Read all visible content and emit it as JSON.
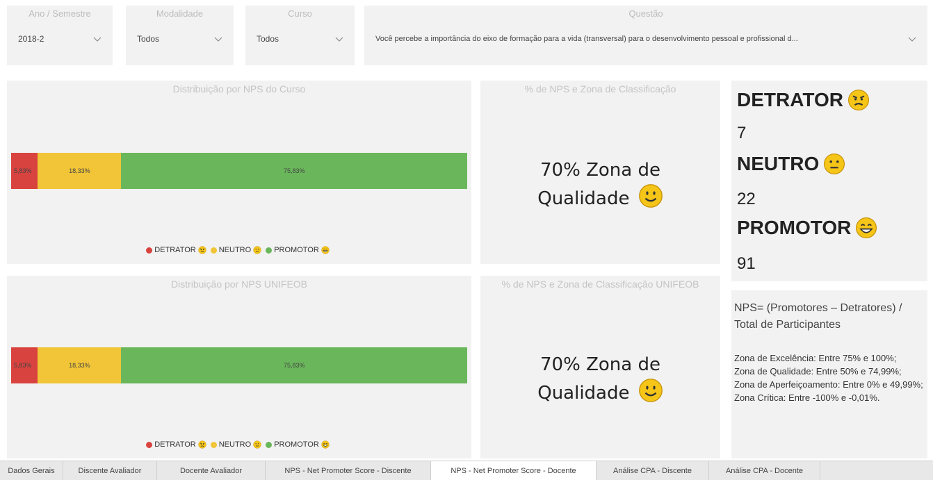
{
  "filters": {
    "ano": {
      "title": "Ano / Semestre",
      "value": "2018-2"
    },
    "modalidade": {
      "title": "Modalidade",
      "value": "Todos"
    },
    "curso": {
      "title": "Curso",
      "value": "Todos"
    },
    "questao": {
      "title": "Questão",
      "value": "Você percebe a importância do eixo de formação para a vida (transversal) para o desenvolvimento pessoal e profissional d..."
    }
  },
  "colors": {
    "detrator": "#d9433f",
    "neutro": "#f1c537",
    "promotor": "#6ab75b",
    "emoji": "#f5c518"
  },
  "chart_data": [
    {
      "type": "bar",
      "title": "Distribuição por NPS do Curso",
      "orientation": "horizontal-stacked-100",
      "series": [
        {
          "name": "DETRATOR",
          "value": 5.83,
          "label": "5,83%"
        },
        {
          "name": "NEUTRO",
          "value": 18.33,
          "label": "18,33%"
        },
        {
          "name": "PROMOTOR",
          "value": 75.83,
          "label": "75,83%"
        }
      ],
      "legend": [
        "DETRATOR",
        "NEUTRO",
        "PROMOTOR"
      ],
      "legend_position": "bottom-center"
    },
    {
      "type": "bar",
      "title": "Distribuição por NPS UNIFEOB",
      "orientation": "horizontal-stacked-100",
      "series": [
        {
          "name": "DETRATOR",
          "value": 5.83,
          "label": "5,83%"
        },
        {
          "name": "NEUTRO",
          "value": 18.33,
          "label": "18,33%"
        },
        {
          "name": "PROMOTOR",
          "value": 75.83,
          "label": "75,83%"
        }
      ],
      "legend": [
        "DETRATOR",
        "NEUTRO",
        "PROMOTOR"
      ],
      "legend_position": "bottom-center"
    }
  ],
  "nps_curso": {
    "title": "% de NPS e Zona de Classificação",
    "line1": "70% Zona de",
    "line2": "Qualidade"
  },
  "nps_unifeob": {
    "title": "% de NPS e Zona de Classificação UNIFEOB",
    "line1": "70% Zona de",
    "line2": "Qualidade"
  },
  "counts": {
    "detrator": {
      "label": "DETRATOR",
      "value": "7"
    },
    "neutro": {
      "label": "NEUTRO",
      "value": "22"
    },
    "promotor": {
      "label": "PROMOTOR",
      "value": "91"
    }
  },
  "formula": {
    "text": "NPS= (Promotores – Detratores) / Total de Participantes",
    "zones": [
      "Zona de Excelência: Entre 75% e 100%;",
      "Zona de Qualidade: Entre 50% e 74,99%;",
      "Zona de Aperfeiçoamento: Entre 0% e 49,99%;",
      "Zona Crítica: Entre -100% e -0,01%."
    ]
  },
  "tabs": [
    {
      "label": "Dados Gerais",
      "active": false
    },
    {
      "label": "Discente Avaliador",
      "active": false
    },
    {
      "label": "Docente Avaliador",
      "active": false
    },
    {
      "label": "NPS - Net Promoter Score - Discente",
      "active": false
    },
    {
      "label": "NPS - Net Promoter Score - Docente",
      "active": true
    },
    {
      "label": "Análise CPA - Discente",
      "active": false
    },
    {
      "label": "Análise CPA - Docente",
      "active": false
    }
  ]
}
